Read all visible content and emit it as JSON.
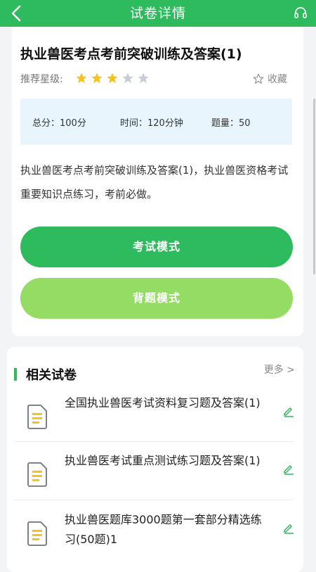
{
  "header": {
    "title": "试卷详情",
    "back_icon": "back-arrow-icon",
    "audio_icon": "headset-icon"
  },
  "paper": {
    "title": "执业兽医考点考前突破训练及答案(1)",
    "rating_label": "推荐星级:",
    "stars_filled": 3,
    "stars_total": 5,
    "favorite_label": "收藏",
    "total_score": "总分：100分",
    "duration": "时间：120分钟",
    "question_count": "题量：50",
    "description": "执业兽医考点考前突破训练及答案(1)，执业兽医资格考试重要知识点练习，考前必做。"
  },
  "buttons": {
    "exam_mode": "考试模式",
    "recite_mode": "背题模式"
  },
  "related": {
    "title": "相关试卷",
    "more": "更多 >",
    "items": [
      {
        "title": "全国执业兽医考试资料复习题及答案(1)"
      },
      {
        "title": "执业兽医考试重点测试练习题及答案(1)"
      },
      {
        "title": "执业兽医题库3000题第一套部分精选练习(50题)1"
      }
    ]
  },
  "colors": {
    "primary": "#2dbb5d",
    "secondary": "#95dc64",
    "star": "#f6c21c",
    "star_empty": "#c7cdd6"
  }
}
